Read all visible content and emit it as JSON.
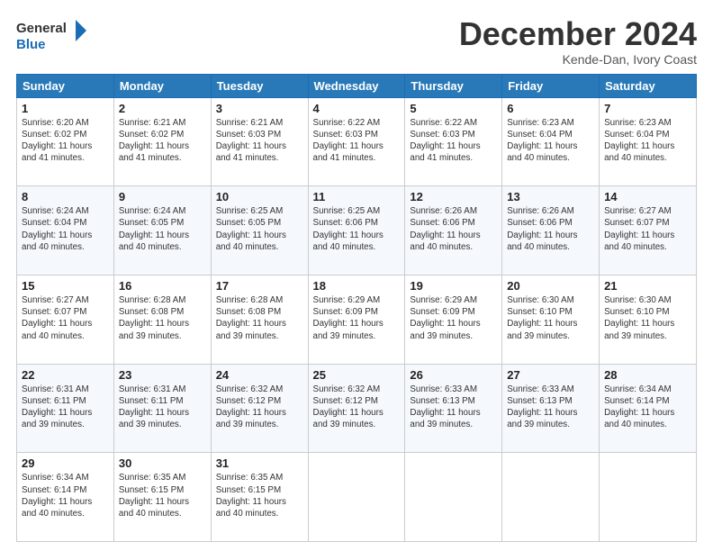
{
  "logo": {
    "line1": "General",
    "line2": "Blue"
  },
  "header": {
    "title": "December 2024",
    "subtitle": "Kende-Dan, Ivory Coast"
  },
  "days_of_week": [
    "Sunday",
    "Monday",
    "Tuesday",
    "Wednesday",
    "Thursday",
    "Friday",
    "Saturday"
  ],
  "weeks": [
    [
      {
        "day": "1",
        "sunrise": "6:20 AM",
        "sunset": "6:02 PM",
        "daylight": "11 hours and 41 minutes."
      },
      {
        "day": "2",
        "sunrise": "6:21 AM",
        "sunset": "6:02 PM",
        "daylight": "11 hours and 41 minutes."
      },
      {
        "day": "3",
        "sunrise": "6:21 AM",
        "sunset": "6:03 PM",
        "daylight": "11 hours and 41 minutes."
      },
      {
        "day": "4",
        "sunrise": "6:22 AM",
        "sunset": "6:03 PM",
        "daylight": "11 hours and 41 minutes."
      },
      {
        "day": "5",
        "sunrise": "6:22 AM",
        "sunset": "6:03 PM",
        "daylight": "11 hours and 41 minutes."
      },
      {
        "day": "6",
        "sunrise": "6:23 AM",
        "sunset": "6:04 PM",
        "daylight": "11 hours and 40 minutes."
      },
      {
        "day": "7",
        "sunrise": "6:23 AM",
        "sunset": "6:04 PM",
        "daylight": "11 hours and 40 minutes."
      }
    ],
    [
      {
        "day": "8",
        "sunrise": "6:24 AM",
        "sunset": "6:04 PM",
        "daylight": "11 hours and 40 minutes."
      },
      {
        "day": "9",
        "sunrise": "6:24 AM",
        "sunset": "6:05 PM",
        "daylight": "11 hours and 40 minutes."
      },
      {
        "day": "10",
        "sunrise": "6:25 AM",
        "sunset": "6:05 PM",
        "daylight": "11 hours and 40 minutes."
      },
      {
        "day": "11",
        "sunrise": "6:25 AM",
        "sunset": "6:06 PM",
        "daylight": "11 hours and 40 minutes."
      },
      {
        "day": "12",
        "sunrise": "6:26 AM",
        "sunset": "6:06 PM",
        "daylight": "11 hours and 40 minutes."
      },
      {
        "day": "13",
        "sunrise": "6:26 AM",
        "sunset": "6:06 PM",
        "daylight": "11 hours and 40 minutes."
      },
      {
        "day": "14",
        "sunrise": "6:27 AM",
        "sunset": "6:07 PM",
        "daylight": "11 hours and 40 minutes."
      }
    ],
    [
      {
        "day": "15",
        "sunrise": "6:27 AM",
        "sunset": "6:07 PM",
        "daylight": "11 hours and 40 minutes."
      },
      {
        "day": "16",
        "sunrise": "6:28 AM",
        "sunset": "6:08 PM",
        "daylight": "11 hours and 39 minutes."
      },
      {
        "day": "17",
        "sunrise": "6:28 AM",
        "sunset": "6:08 PM",
        "daylight": "11 hours and 39 minutes."
      },
      {
        "day": "18",
        "sunrise": "6:29 AM",
        "sunset": "6:09 PM",
        "daylight": "11 hours and 39 minutes."
      },
      {
        "day": "19",
        "sunrise": "6:29 AM",
        "sunset": "6:09 PM",
        "daylight": "11 hours and 39 minutes."
      },
      {
        "day": "20",
        "sunrise": "6:30 AM",
        "sunset": "6:10 PM",
        "daylight": "11 hours and 39 minutes."
      },
      {
        "day": "21",
        "sunrise": "6:30 AM",
        "sunset": "6:10 PM",
        "daylight": "11 hours and 39 minutes."
      }
    ],
    [
      {
        "day": "22",
        "sunrise": "6:31 AM",
        "sunset": "6:11 PM",
        "daylight": "11 hours and 39 minutes."
      },
      {
        "day": "23",
        "sunrise": "6:31 AM",
        "sunset": "6:11 PM",
        "daylight": "11 hours and 39 minutes."
      },
      {
        "day": "24",
        "sunrise": "6:32 AM",
        "sunset": "6:12 PM",
        "daylight": "11 hours and 39 minutes."
      },
      {
        "day": "25",
        "sunrise": "6:32 AM",
        "sunset": "6:12 PM",
        "daylight": "11 hours and 39 minutes."
      },
      {
        "day": "26",
        "sunrise": "6:33 AM",
        "sunset": "6:13 PM",
        "daylight": "11 hours and 39 minutes."
      },
      {
        "day": "27",
        "sunrise": "6:33 AM",
        "sunset": "6:13 PM",
        "daylight": "11 hours and 39 minutes."
      },
      {
        "day": "28",
        "sunrise": "6:34 AM",
        "sunset": "6:14 PM",
        "daylight": "11 hours and 40 minutes."
      }
    ],
    [
      {
        "day": "29",
        "sunrise": "6:34 AM",
        "sunset": "6:14 PM",
        "daylight": "11 hours and 40 minutes."
      },
      {
        "day": "30",
        "sunrise": "6:35 AM",
        "sunset": "6:15 PM",
        "daylight": "11 hours and 40 minutes."
      },
      {
        "day": "31",
        "sunrise": "6:35 AM",
        "sunset": "6:15 PM",
        "daylight": "11 hours and 40 minutes."
      },
      null,
      null,
      null,
      null
    ]
  ]
}
